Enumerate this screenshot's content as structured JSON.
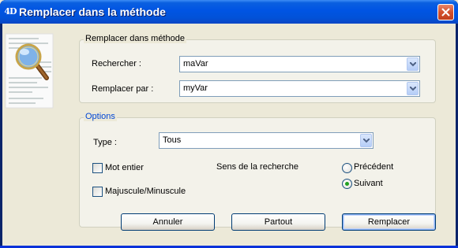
{
  "window": {
    "title": "Remplacer dans la méthode",
    "app_logo_text": "4D"
  },
  "replace_group": {
    "legend": "Remplacer dans méthode",
    "search_label": "Rechercher :",
    "search_value": "maVar",
    "replace_label": "Remplacer par :",
    "replace_value": "myVar"
  },
  "options_group": {
    "legend": "Options",
    "type_label": "Type :",
    "type_value": "Tous",
    "whole_word_label": "Mot entier",
    "whole_word_checked": false,
    "case_label": "Majuscule/Minuscule",
    "case_checked": false,
    "direction_label": "Sens de la recherche",
    "previous_label": "Précédent",
    "next_label": "Suivant",
    "direction_selected": "Suivant"
  },
  "buttons": {
    "cancel": "Annuler",
    "all": "Partout",
    "replace": "Remplacer"
  },
  "colors": {
    "titlebar": "#0054e3",
    "options_legend": "#0046d5",
    "radio_dot": "#21a121"
  }
}
